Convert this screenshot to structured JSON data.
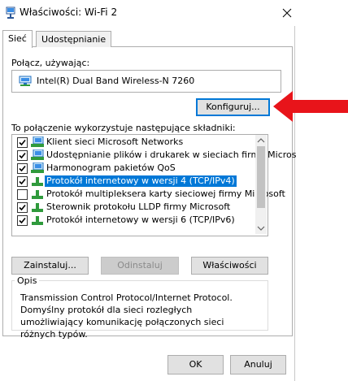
{
  "window": {
    "title": "Właściwości: Wi-Fi 2",
    "close_icon": "close-icon",
    "title_icon": "network-icon"
  },
  "tabs": [
    {
      "label": "Sieć",
      "selected": true
    },
    {
      "label": "Udostępnianie",
      "selected": false
    }
  ],
  "connect": {
    "label": "Połącz, używając:",
    "adapter_name": "Intel(R) Dual Band Wireless-N 7260",
    "adapter_icon": "network-adapter-icon",
    "configure_label": "Konfiguruj..."
  },
  "annotation": {
    "arrow_color": "#e8141a",
    "arrow_icon": "arrow-left-icon"
  },
  "components": {
    "label": "To połączenie wykorzystuje następujące składniki:",
    "items": [
      {
        "label": "Klient sieci Microsoft Networks",
        "checked": true,
        "icon": "client-icon",
        "selected": false
      },
      {
        "label": "Udostępnianie plików i drukarek w sieciach firmy Micros",
        "checked": true,
        "icon": "service-icon",
        "selected": false
      },
      {
        "label": "Harmonogram pakietów QoS",
        "checked": true,
        "icon": "service-icon",
        "selected": false
      },
      {
        "label": "Protokół internetowy w wersji 4 (TCP/IPv4)",
        "checked": true,
        "icon": "protocol-icon",
        "selected": true
      },
      {
        "label": "Protokół multipleksera karty sieciowej firmy Microsoft",
        "checked": false,
        "icon": "protocol-icon",
        "selected": false
      },
      {
        "label": "Sterownik protokołu LLDP firmy Microsoft",
        "checked": true,
        "icon": "protocol-icon",
        "selected": false
      },
      {
        "label": "Protokół internetowy w wersji 6 (TCP/IPv6)",
        "checked": true,
        "icon": "protocol-icon",
        "selected": false
      }
    ]
  },
  "buttons": {
    "install": "Zainstaluj...",
    "uninstall": "Odinstaluj",
    "properties": "Właściwości",
    "ok": "OK",
    "cancel": "Anuluj"
  },
  "description": {
    "title": "Opis",
    "text": "Transmission Control Protocol/Internet Protocol. Domyślny protokół dla sieci rozległych umożliwiający komunikację połączonych sieci różnych typów."
  },
  "colors": {
    "selection": "#0078d7",
    "accent": "#0078d7"
  }
}
